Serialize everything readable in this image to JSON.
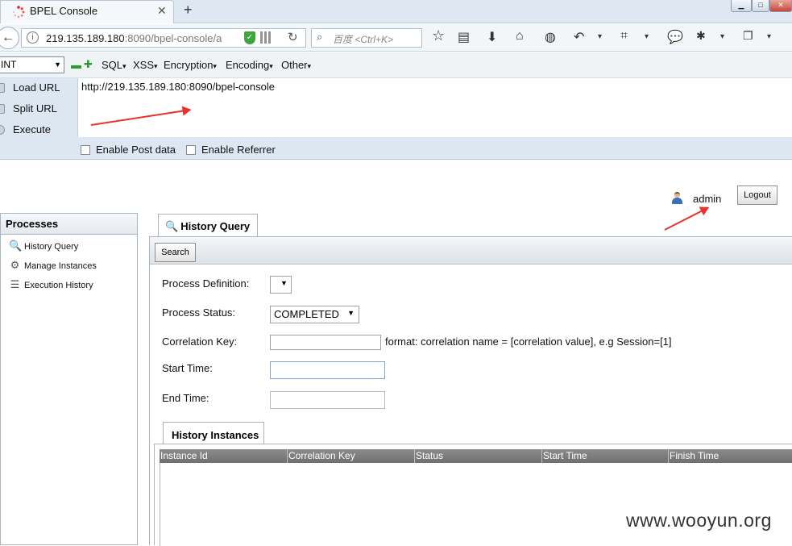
{
  "browser": {
    "tab_title": "BPEL Console",
    "tab_close": "✕",
    "new_tab": "+",
    "url_host": "219.135.189.180",
    "url_rest": ":8090/bpel-console/a",
    "search_placeholder": "百度 <Ctrl+K>"
  },
  "hackbar": {
    "encoding_select": "INT",
    "menus": [
      "SQL",
      "XSS",
      "Encryption",
      "Encoding",
      "Other"
    ],
    "actions": {
      "load_url": "Load URL",
      "split_url": "Split URL",
      "execute": "Execute"
    },
    "url_value": "http://219.135.189.180:8090/bpel-console",
    "enable_post": "Enable Post data",
    "enable_referrer": "Enable Referrer"
  },
  "header": {
    "user_name": "admin",
    "logout_label": "Logout"
  },
  "sidebar": {
    "title": "Processes",
    "items": [
      {
        "label": "History Query",
        "icon": "magnifier-icon"
      },
      {
        "label": "Manage Instances",
        "icon": "gears-icon"
      },
      {
        "label": "Execution History",
        "icon": "database-icon"
      }
    ]
  },
  "main": {
    "tab_label": "History Query",
    "search_button": "Search",
    "form": {
      "process_definition_label": "Process Definition:",
      "process_status_label": "Process Status:",
      "process_status_value": "COMPLETED",
      "correlation_key_label": "Correlation Key:",
      "correlation_hint": "format: correlation name = [correlation value], e.g Session=[1]",
      "start_time_label": "Start Time:",
      "end_time_label": "End Time:"
    },
    "instances_tab_label": "History Instances",
    "columns": [
      "Instance Id",
      "Correlation Key",
      "Status",
      "Start Time",
      "Finish Time"
    ]
  },
  "watermark": "www.wooyun.org",
  "colors": {
    "annotation_arrow": "#e8322a",
    "grid_header": "#7a7a7a",
    "hackbar_bg": "#dde7f1"
  }
}
